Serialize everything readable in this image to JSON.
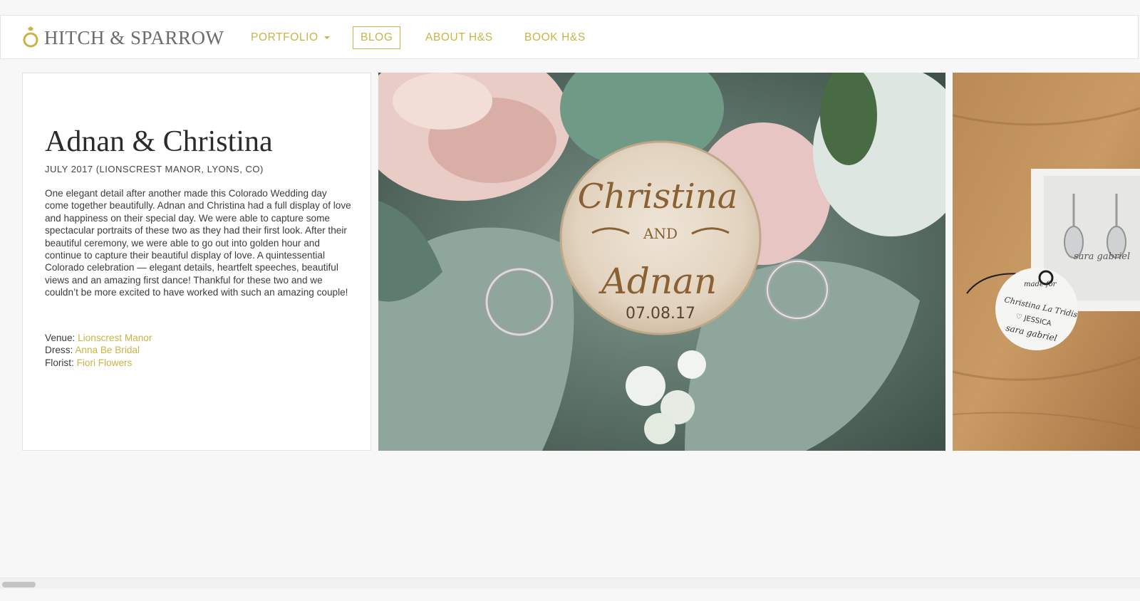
{
  "brand": {
    "name": "HITCH & SPARROW",
    "accent_color": "#c9b445",
    "logo_icon": "ring-icon"
  },
  "nav": {
    "portfolio": "PORTFOLIO",
    "blog": "BLOG",
    "about": "ABOUT H&S",
    "book": "BOOK H&S",
    "active": "BLOG"
  },
  "post": {
    "title": "Adnan & Christina",
    "subtitle": "JULY 2017 (LIONSCREST MANOR, LYONS, CO)",
    "description": "One elegant detail after another made this Colorado Wedding day come together beautifully. Adnan and Christina had a full display of love and happiness on their special day. We were able to capture some spectacular portraits of these two as they had their first look. After their beautiful ceremony, we were able to go out into golden hour and continue to capture their beautiful display of love. A quintessential Colorado celebration — elegant details, heartfelt speeches, beautiful views and an amazing first dance! Thankful for these two and we couldn’t be more excited to have worked with such an amazing couple!",
    "credits": [
      {
        "label": "Venue:",
        "value": "Lionscrest Manor"
      },
      {
        "label": "Dress:",
        "value": "Anna Be Bridal"
      },
      {
        "label": "Florist:",
        "value": "Fiori Flowers"
      }
    ]
  },
  "photos": {
    "rings": {
      "name_top": "Christina",
      "and": "AND",
      "name_bottom": "Adnan",
      "date": "07.08.17"
    },
    "earrings": {
      "tag_line1": "made for",
      "tag_line2": "Christina La Tridis",
      "tag_line3": "♡ JESSICA",
      "tag_line4": "sara gabriel",
      "card_text": "sara gabriel"
    }
  }
}
